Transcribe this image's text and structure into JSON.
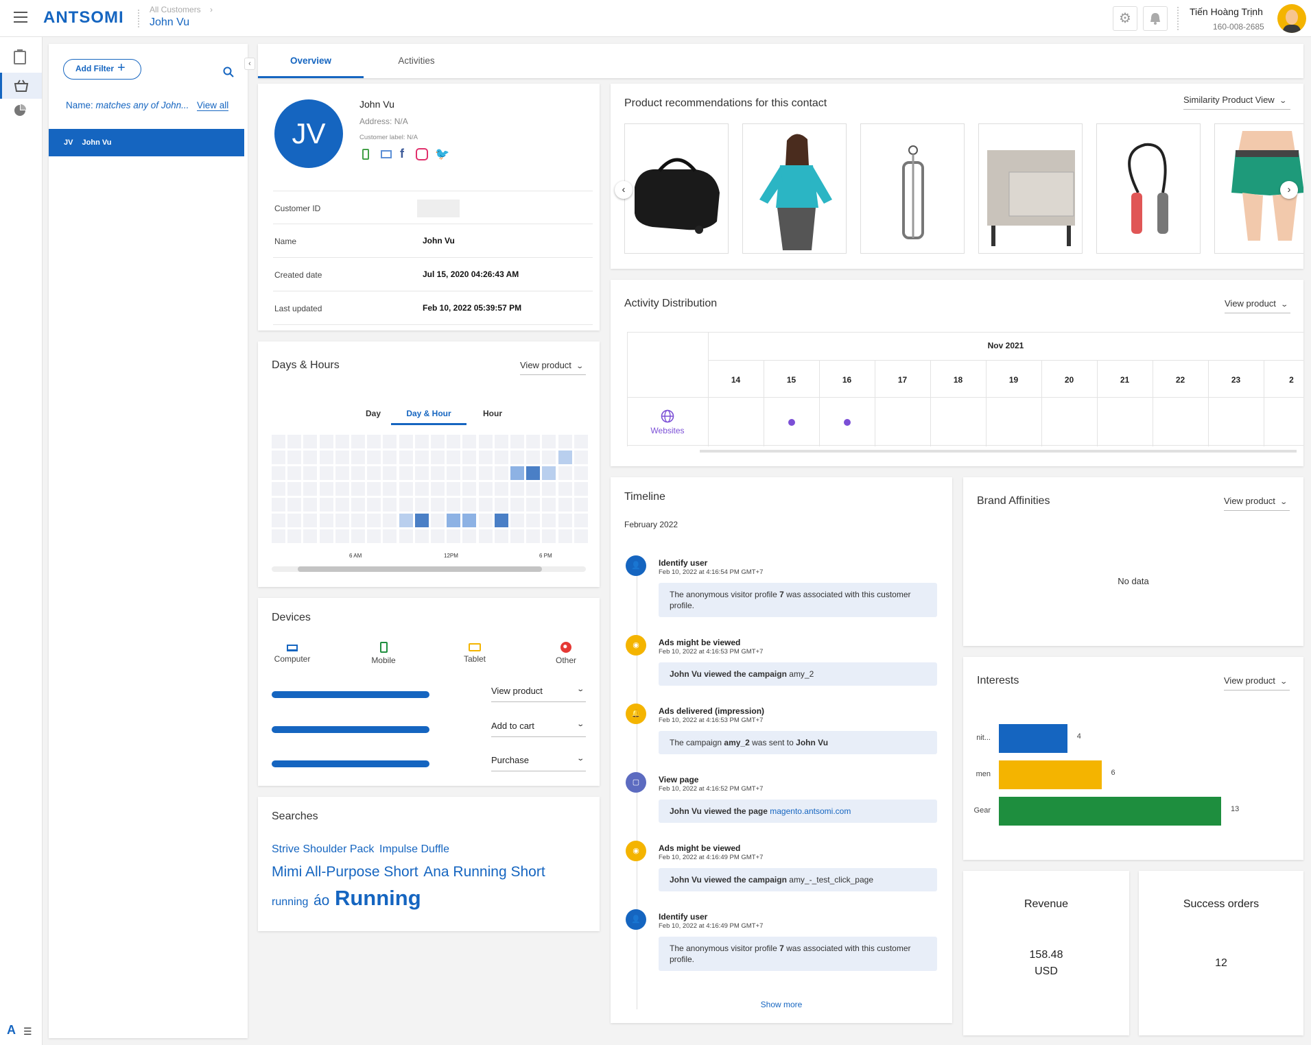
{
  "header": {
    "logo": "ANTSOMI",
    "breadcrumb_parent": "All Customers",
    "breadcrumb_current": "John Vu",
    "user_name": "Tiến Hoàng Trịnh",
    "user_id": "160-008-2685"
  },
  "filter_panel": {
    "add_filter_label": "Add Filter",
    "filter_text_prefix": "Name: ",
    "filter_text_value": "matches any of John...",
    "view_all_label": "View all",
    "selected_item": {
      "initials": "JV",
      "name": "John Vu"
    }
  },
  "tabs": [
    {
      "label": "Overview",
      "active": true
    },
    {
      "label": "Activities",
      "active": false
    }
  ],
  "profile": {
    "initials": "JV",
    "name": "John Vu",
    "address": "Address: N/A",
    "customer_label": "Customer label: N/A",
    "rows": [
      {
        "key": "Customer ID",
        "value": ""
      },
      {
        "key": "Name",
        "value": "John Vu"
      },
      {
        "key": "Created date",
        "value": "Jul 15, 2020 04:26:43 AM"
      },
      {
        "key": "Last updated",
        "value": "Feb 10, 2022 05:39:57 PM"
      }
    ]
  },
  "recommendations": {
    "title": "Product recommendations for this contact",
    "view_select": "Similarity Product View",
    "products": [
      "duffle-bag",
      "women-top",
      "bottle-cage",
      "side-table",
      "jump-rope",
      "women-shorts"
    ]
  },
  "days_hours": {
    "title": "Days & Hours",
    "view_select": "View product",
    "subtabs": [
      "Day",
      "Day & Hour",
      "Hour"
    ],
    "active_subtab": "Day & Hour",
    "axis_labels": [
      "6 AM",
      "12PM",
      "6 PM"
    ],
    "cells": [
      {
        "row": 1,
        "col": 18,
        "level": 1
      },
      {
        "row": 2,
        "col": 15,
        "level": 2
      },
      {
        "row": 2,
        "col": 16,
        "level": 3
      },
      {
        "row": 2,
        "col": 17,
        "level": 1
      },
      {
        "row": 5,
        "col": 8,
        "level": 1
      },
      {
        "row": 5,
        "col": 9,
        "level": 3
      },
      {
        "row": 5,
        "col": 11,
        "level": 2
      },
      {
        "row": 5,
        "col": 12,
        "level": 2
      },
      {
        "row": 5,
        "col": 14,
        "level": 3
      }
    ]
  },
  "devices": {
    "title": "Devices",
    "types": [
      {
        "label": "Computer",
        "color": "#1565c0",
        "icon": "computer-icon"
      },
      {
        "label": "Mobile",
        "color": "#1e8e3e",
        "icon": "mobile-icon"
      },
      {
        "label": "Tablet",
        "color": "#f4b400",
        "icon": "tablet-icon"
      },
      {
        "label": "Other",
        "color": "#e53935",
        "icon": "globe-icon"
      }
    ],
    "rows": [
      {
        "select": "View product",
        "fraction": 1
      },
      {
        "select": "Add to cart",
        "fraction": 1
      },
      {
        "select": "Purchase",
        "fraction": 1
      }
    ]
  },
  "searches": {
    "title": "Searches",
    "lines": [
      [
        {
          "text": "Strive Shoulder Pack",
          "size": 16
        },
        {
          "text": "Impulse Duffle",
          "size": 16
        }
      ],
      [
        {
          "text": "Mimi All-Purpose Short",
          "size": 21
        },
        {
          "text": "Ana Running Short",
          "size": 21
        }
      ],
      [
        {
          "text": "running",
          "size": 16
        },
        {
          "text": "áo",
          "size": 21
        },
        {
          "text": "Running",
          "size": 31
        }
      ]
    ]
  },
  "activity_distribution": {
    "title": "Activity Distribution",
    "view_select": "View product",
    "month": "Nov 2021",
    "days": [
      "14",
      "15",
      "16",
      "17",
      "18",
      "19",
      "20",
      "21",
      "22",
      "23",
      "2"
    ],
    "channel": "Websites",
    "active_days": [
      "15",
      "16"
    ]
  },
  "timeline": {
    "title": "Timeline",
    "month": "February 2022",
    "show_more": "Show more",
    "items": [
      {
        "title": "Identify user",
        "time": "Feb 10, 2022 at 4:16:54 PM GMT+7",
        "icon": "user-check-icon",
        "color": "#1565c0",
        "parts": [
          "The anonymous visitor profile ",
          "7",
          " was associated with this customer profile."
        ]
      },
      {
        "title": "Ads might be viewed",
        "time": "Feb 10, 2022 at 4:16:53 PM GMT+7",
        "icon": "eye-icon",
        "color": "#f4b400",
        "parts": [
          "John Vu",
          " viewed the campaign ",
          "amy_2"
        ]
      },
      {
        "title": "Ads delivered (impression)",
        "time": "Feb 10, 2022 at 4:16:53 PM GMT+7",
        "icon": "bell-icon",
        "color": "#f4b400",
        "parts": [
          "The campaign ",
          "amy_2",
          " was sent to ",
          "John Vu"
        ]
      },
      {
        "title": "View page",
        "time": "Feb 10, 2022 at 4:16:52 PM GMT+7",
        "icon": "page-icon",
        "color": "#5c6bc0",
        "parts": [
          "John Vu",
          " viewed the page ",
          "magento.antsomi.com"
        ]
      },
      {
        "title": "Ads might be viewed",
        "time": "Feb 10, 2022 at 4:16:49 PM GMT+7",
        "icon": "eye-icon",
        "color": "#f4b400",
        "parts": [
          "John Vu",
          " viewed the campaign ",
          "amy_-_test_click_page"
        ]
      },
      {
        "title": "Identify user",
        "time": "Feb 10, 2022 at 4:16:49 PM GMT+7",
        "icon": "user-check-icon",
        "color": "#1565c0",
        "parts": [
          "The anonymous visitor profile ",
          "7",
          " was associated with this customer profile."
        ]
      }
    ]
  },
  "brand_affinities": {
    "title": "Brand Affinities",
    "view_select": "View product",
    "empty": "No data"
  },
  "interests": {
    "title": "Interests",
    "view_select": "View product",
    "bars": [
      {
        "label": "nit...",
        "value": 4,
        "color": "#1565c0"
      },
      {
        "label": "men",
        "value": 6,
        "color": "#f4b400"
      },
      {
        "label": "Gear",
        "value": 13,
        "color": "#1e8e3e"
      }
    ]
  },
  "revenue": {
    "title": "Revenue",
    "value": "158.48",
    "unit": "USD"
  },
  "orders": {
    "title": "Success orders",
    "value": "12"
  }
}
